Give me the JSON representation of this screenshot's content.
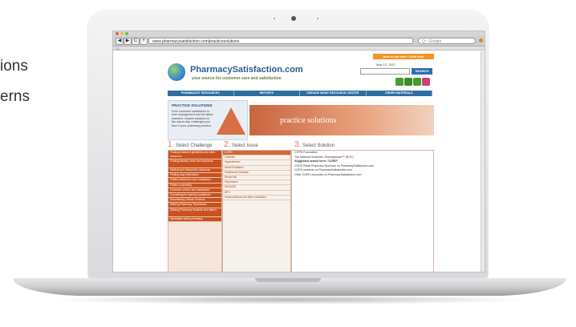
{
  "side_text": {
    "line1": "ions",
    "line2": "erns"
  },
  "browser": {
    "nav_back": "◀",
    "nav_fwd": "▶",
    "nav_reload": "C",
    "nav_add": "+",
    "url": "www.pharmacysatisfaction.com/practicesolutions",
    "search_placeholder": "Q~ Google",
    "bookmarks_label": "□□"
  },
  "site": {
    "banner_new": "New to the site? Click here",
    "date": "May 13, 2011",
    "search_button": "SEARCH",
    "logo_title": "PharmacySatisfaction.com",
    "logo_tagline": "your source for customer care and satisfaction",
    "nav": [
      "PHARMACIST RESOURCES",
      "REPORTS",
      "DISEASE MGMT RESOURCE CENTER",
      "ORDER MATERIALS"
    ],
    "ps_title": "PRACTICE SOLUTIONS",
    "ps_desc": "From customer satisfaction to time management and the latest research, explore solutions to the day-to-day challenges you face in your pharmacy practice.",
    "hero_text": "practice solutions",
    "steps": [
      {
        "num": "1.",
        "label": "Select Challenge"
      },
      {
        "num": "2.",
        "label": "Select Issue"
      },
      {
        "num": "3.",
        "label": "Select Solution"
      }
    ],
    "challenges": [
      "Finding treatment guidelines and other resources",
      "Finding industry news and resources",
      "Medical and clinical trial resources",
      "Finding drug information",
      "Patient adherence and compliance",
      "Patient counseling",
      "Customer service and satisfaction",
      "Counseling for special populations",
      "Streamlining Clinical Services",
      "Utilizing Pharmacy Technicians",
      "Utilizing Pharmacy students and interns",
      "Specialties within pharmacy"
    ],
    "issues": [
      "COPD",
      "Diabetes",
      "Hypertension",
      "Atrial Fibrillation",
      "Parkinson's Disease",
      "Renal Fail",
      "Depression",
      "HIV/AIDS",
      "BPH",
      "Immunizations and other conditions"
    ],
    "solutions": [
      {
        "text": "COPD Foundation",
        "bold": false
      },
      {
        "text": "The National Guideline Clearinghouse™ (NGC)",
        "bold": false
      },
      {
        "text": "Suggested search term: \"COPD\"",
        "bold": true
      },
      {
        "text": "COPD Retail Pharmacy Brochure on PharmacySatisfaction.com",
        "bold": false
      },
      {
        "text": "COPD screener on PharmacySatisfaction.com",
        "bold": false
      },
      {
        "text": "Other COPD resources on PharmacySatisfaction.com",
        "bold": false
      }
    ]
  },
  "colors": {
    "brand_blue": "#2f6ea3",
    "accent_orange": "#c9521f",
    "banner_orange": "#f29428"
  }
}
